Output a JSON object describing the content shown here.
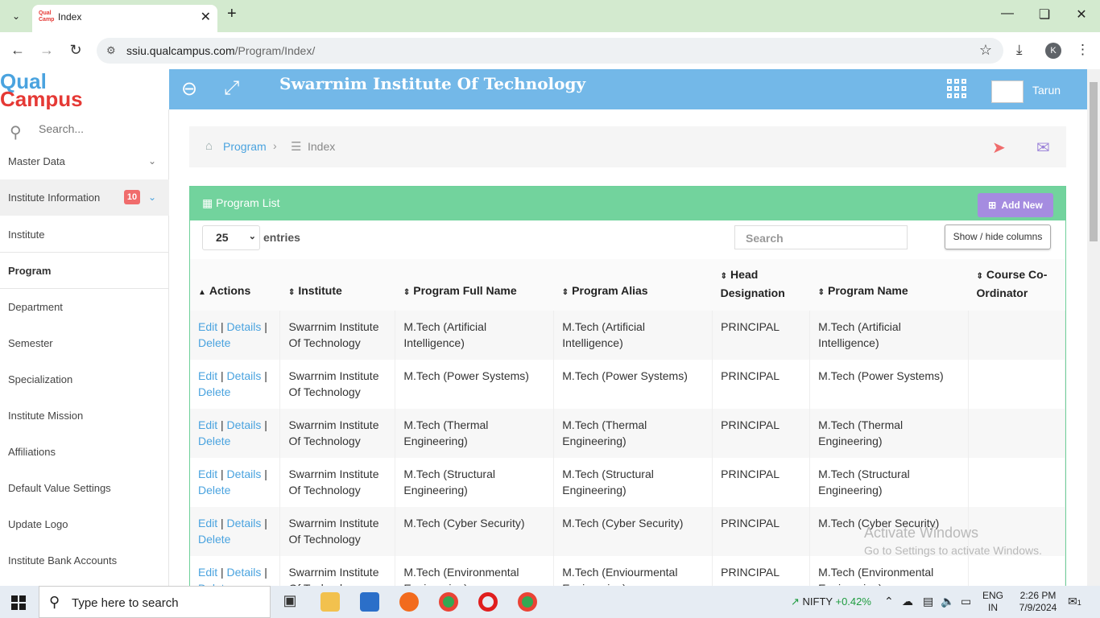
{
  "browser": {
    "tab_title": "Index",
    "url_host": "ssiu.qualcampus.com",
    "url_path": "/Program/Index/",
    "profile_initial": "K"
  },
  "header": {
    "logo_top": "Qual",
    "logo_bottom": "Campus",
    "institute_title": "Swarrnim Institute Of Technology",
    "user_name": "Tarun"
  },
  "sidebar": {
    "search_placeholder": "Search...",
    "items": [
      {
        "label": "Master Data"
      },
      {
        "label": "Institute Information",
        "badge": "10"
      },
      {
        "label": "Institute"
      },
      {
        "label": "Program"
      },
      {
        "label": "Department"
      },
      {
        "label": "Semester"
      },
      {
        "label": "Specialization"
      },
      {
        "label": "Institute Mission"
      },
      {
        "label": "Affiliations"
      },
      {
        "label": "Default Value Settings"
      },
      {
        "label": "Update Logo"
      },
      {
        "label": "Institute Bank Accounts"
      }
    ]
  },
  "breadcrumb": {
    "root": "Program",
    "current": "Index"
  },
  "panel": {
    "title": "Program List",
    "add_new": "Add New",
    "page_length": "25",
    "entries_label": "entries",
    "search_placeholder": "Search",
    "show_hide": "Show / hide columns"
  },
  "table": {
    "headers": [
      "Actions",
      "Institute",
      "Program Full Name",
      "Program Alias",
      "Head Designation",
      "Program Name",
      "Course Co-Ordinator"
    ],
    "action_labels": {
      "edit": "Edit",
      "details": "Details",
      "delete": "Delete",
      "sep": "|"
    },
    "rows": [
      {
        "institute": "Swarrnim Institute Of Technology",
        "full_name": "M.Tech (Artificial Intelligence)",
        "alias": "M.Tech (Artificial Intelligence)",
        "head": "PRINCIPAL",
        "name": "M.Tech (Artificial Intelligence)",
        "coordinator": ""
      },
      {
        "institute": "Swarrnim Institute Of Technology",
        "full_name": "M.Tech (Power Systems)",
        "alias": "M.Tech (Power Systems)",
        "head": "PRINCIPAL",
        "name": "M.Tech (Power Systems)",
        "coordinator": ""
      },
      {
        "institute": "Swarrnim Institute Of Technology",
        "full_name": "M.Tech (Thermal Engineering)",
        "alias": "M.Tech (Thermal Engineering)",
        "head": "PRINCIPAL",
        "name": "M.Tech (Thermal Engineering)",
        "coordinator": ""
      },
      {
        "institute": "Swarrnim Institute Of Technology",
        "full_name": "M.Tech (Structural Engineering)",
        "alias": "M.Tech (Structural Engineering)",
        "head": "PRINCIPAL",
        "name": "M.Tech (Structural Engineering)",
        "coordinator": ""
      },
      {
        "institute": "Swarrnim Institute Of Technology",
        "full_name": "M.Tech (Cyber Security)",
        "alias": "M.Tech (Cyber Security)",
        "head": "PRINCIPAL",
        "name": "M.Tech (Cyber Security)",
        "coordinator": ""
      },
      {
        "institute": "Swarrnim Institute Of Technology",
        "full_name": "M.Tech (Environmental Engineering)",
        "alias": "M.Tech (Enviourmental Engineering)",
        "head": "PRINCIPAL",
        "name": "M.Tech (Environmental Engineering)",
        "coordinator": ""
      }
    ]
  },
  "watermark": {
    "line1": "Activate Windows",
    "line2": "Go to Settings to activate Windows."
  },
  "taskbar": {
    "search_text": "Type here to search",
    "nifty_label": "NIFTY",
    "nifty_change": "+0.42%",
    "lang_top": "ENG",
    "lang_bottom": "IN",
    "time": "2:26 PM",
    "date": "7/9/2024",
    "notif_count": "1"
  },
  "colors": {
    "header_blue": "#73b8e8",
    "panel_green": "#72d39d",
    "add_new_purple": "#a58ce0",
    "link_blue": "#4aa3df",
    "badge_red": "#f06c6c"
  }
}
